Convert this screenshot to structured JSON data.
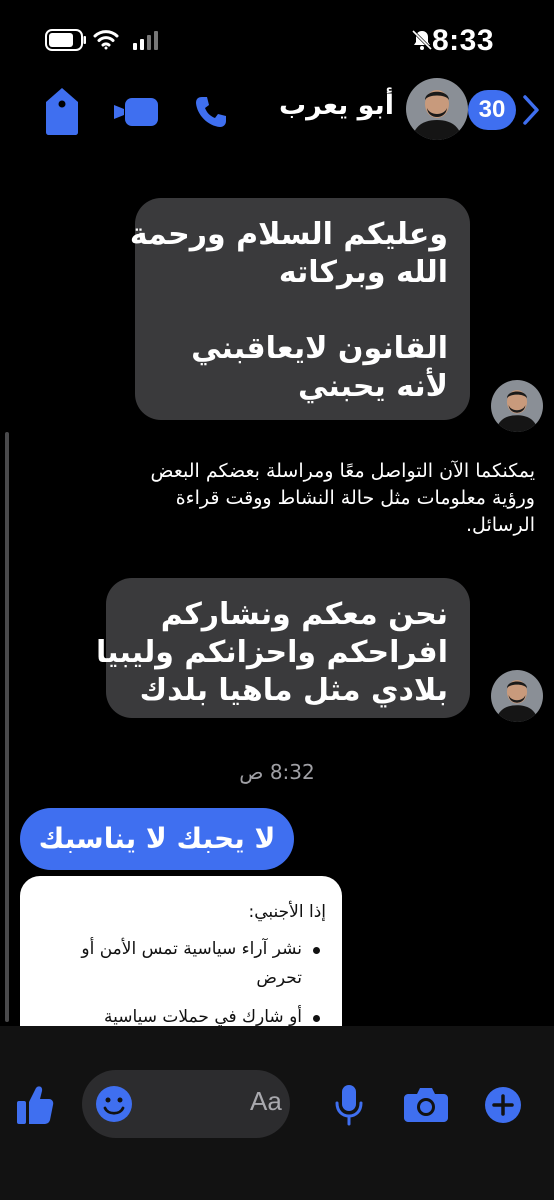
{
  "status_bar": {
    "time": "8:33"
  },
  "header": {
    "badge_count": "30",
    "contact_name": "أبو يعرب",
    "icons": [
      "chevron-left-icon",
      "avatar",
      "phone-icon",
      "video-camera-icon",
      "tag-icon"
    ]
  },
  "messages": {
    "msg1": {
      "lines_a": [
        "وعليكم السلام ورحمة",
        "الله وبركاته"
      ],
      "lines_b": [
        "القانون لايعاقبني",
        "لأنه يحبني"
      ]
    },
    "notice": [
      "يمكنكما الآن التواصل معًا ومراسلة بعضكم البعض",
      "ورؤية معلومات مثل حالة النشاط ووقت قراءة",
      "الرسائل."
    ],
    "msg2": [
      "نحن معكم ونشاركم",
      "افراحكم واحزانكم وليبيا",
      "بلادي مثل ماهيا بلدك"
    ],
    "timestamp": "8:32 ص",
    "outgoing": "لا يحبك لا يناسبك",
    "card": {
      "title": "إذا الأجنبي:",
      "bullets": [
        "نشر آراء سياسية تمس الأمن أو تحرض",
        "أو شارك في حملات سياسية"
      ]
    }
  },
  "composer": {
    "placeholder": "Aa"
  },
  "colors": {
    "accent": "#3f6ff0",
    "incoming_bubble": "#3a3a3c",
    "background": "#000000"
  }
}
